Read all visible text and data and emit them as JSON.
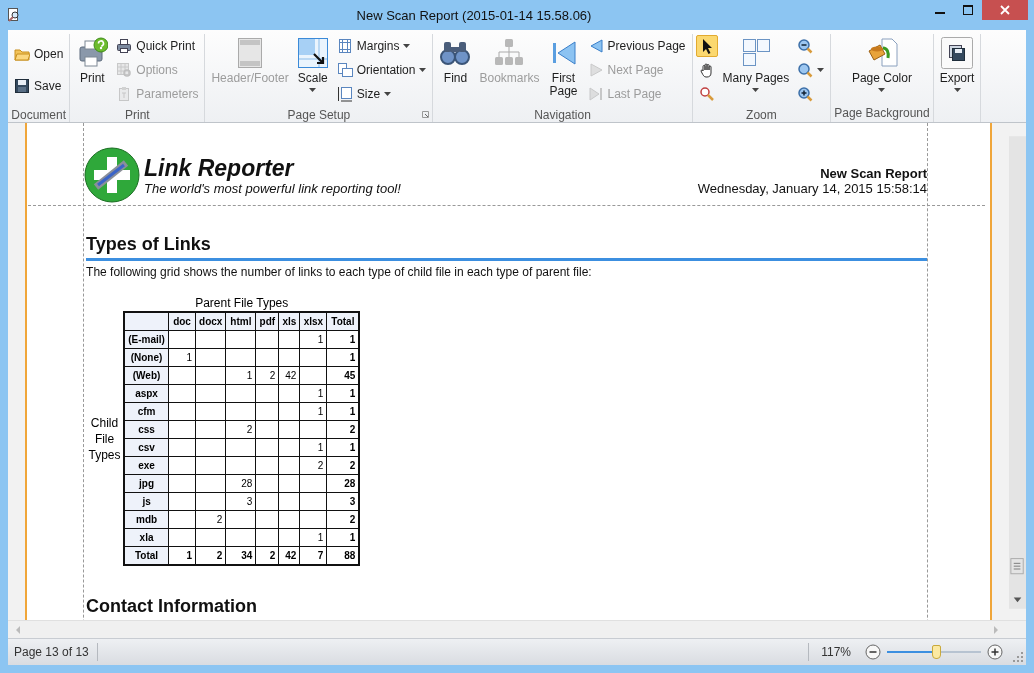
{
  "window": {
    "title": "New Scan Report (2015-01-14 15.58.06)"
  },
  "ribbon": {
    "groups": [
      {
        "label": "Document",
        "items": [
          {
            "label": "Open",
            "kind": "open",
            "disabled": false
          },
          {
            "label": "Save",
            "kind": "save",
            "disabled": false
          }
        ]
      },
      {
        "label": "Print",
        "items": [
          {
            "label": "Print",
            "kind": "print",
            "disabled": false
          },
          {
            "label": "Quick Print",
            "kind": "quickprint",
            "disabled": false
          },
          {
            "label": "Options",
            "kind": "options",
            "disabled": true
          },
          {
            "label": "Parameters",
            "kind": "parameters",
            "disabled": true
          }
        ]
      },
      {
        "label": "Page Setup",
        "launcher": true,
        "items": [
          {
            "label": "Header/Footer",
            "kind": "headerfooter",
            "disabled": true
          },
          {
            "label": "Scale",
            "kind": "scale",
            "disabled": false,
            "dropdown": true
          },
          {
            "label": "Margins",
            "kind": "margins",
            "disabled": false,
            "dropdown": true
          },
          {
            "label": "Orientation",
            "kind": "orientation",
            "disabled": false,
            "dropdown": true
          },
          {
            "label": "Size",
            "kind": "size",
            "disabled": false,
            "dropdown": true
          }
        ]
      },
      {
        "label": "Navigation",
        "items": [
          {
            "label": "Find",
            "kind": "find",
            "disabled": false
          },
          {
            "label": "Bookmarks",
            "kind": "bookmarks",
            "disabled": true
          },
          {
            "label": "First\nPage",
            "kind": "first",
            "disabled": false
          },
          {
            "label": "Previous Page",
            "kind": "previous",
            "disabled": false
          },
          {
            "label": "Next Page",
            "kind": "next",
            "disabled": true
          },
          {
            "label": "Last Page",
            "kind": "last",
            "disabled": true
          }
        ]
      },
      {
        "label": "Zoom",
        "items": [
          {
            "kind": "pointer",
            "disabled": false,
            "selected": true
          },
          {
            "kind": "hand",
            "disabled": false,
            "selected": false
          },
          {
            "kind": "magnifier",
            "disabled": false,
            "selected": false
          },
          {
            "label": "Many Pages",
            "kind": "manypages",
            "disabled": false,
            "dropdown": true
          },
          {
            "kind": "zoomout",
            "disabled": false
          },
          {
            "kind": "zoom",
            "disabled": false,
            "dropdown": true
          },
          {
            "kind": "zoomin",
            "disabled": false
          }
        ]
      },
      {
        "label": "Page Background",
        "items": [
          {
            "label": "Page Color",
            "kind": "pagecolor",
            "disabled": false,
            "dropdown": true
          }
        ]
      },
      {
        "items": [
          {
            "label": "Export",
            "kind": "export",
            "disabled": false,
            "dropdown": true
          }
        ]
      }
    ]
  },
  "report": {
    "brand": "Link Reporter",
    "tagline": "The world's most powerful link reporting tool!",
    "report_title": "New Scan Report",
    "date": "Wednesday, January 14, 2015 15:58:14",
    "section_title": "Types of Links",
    "intro": "The following grid shows the number of links to each type of child file in each type of parent file:",
    "table": {
      "caption": "Parent File Types",
      "row_axis": "Child File Types",
      "columns": [
        "doc",
        "docx",
        "html",
        "pdf",
        "xls",
        "xlsx",
        "Total"
      ],
      "rows": [
        {
          "header": "(E-mail)",
          "cells": [
            null,
            null,
            null,
            null,
            null,
            "1",
            "1"
          ]
        },
        {
          "header": "(None)",
          "cells": [
            "1",
            null,
            null,
            null,
            null,
            null,
            "1"
          ]
        },
        {
          "header": "(Web)",
          "cells": [
            null,
            null,
            "1",
            "2",
            "42",
            null,
            "45"
          ]
        },
        {
          "header": "aspx",
          "cells": [
            null,
            null,
            null,
            null,
            null,
            "1",
            "1"
          ]
        },
        {
          "header": "cfm",
          "cells": [
            null,
            null,
            null,
            null,
            null,
            "1",
            "1"
          ]
        },
        {
          "header": "css",
          "cells": [
            null,
            null,
            "2",
            null,
            null,
            null,
            "2"
          ]
        },
        {
          "header": "csv",
          "cells": [
            null,
            null,
            null,
            null,
            null,
            "1",
            "1"
          ]
        },
        {
          "header": "exe",
          "cells": [
            null,
            null,
            null,
            null,
            null,
            "2",
            "2"
          ]
        },
        {
          "header": "jpg",
          "cells": [
            null,
            null,
            "28",
            null,
            null,
            null,
            "28"
          ]
        },
        {
          "header": "js",
          "cells": [
            null,
            null,
            "3",
            null,
            null,
            null,
            "3"
          ]
        },
        {
          "header": "mdb",
          "cells": [
            null,
            "2",
            null,
            null,
            null,
            null,
            "2"
          ]
        },
        {
          "header": "xla",
          "cells": [
            null,
            null,
            null,
            null,
            null,
            "1",
            "1"
          ]
        },
        {
          "header": "Total",
          "cells": [
            "1",
            "2",
            "34",
            "2",
            "42",
            "7",
            "88"
          ]
        }
      ]
    },
    "next_section_title": "Contact Information"
  },
  "status_bar": {
    "page": "Page 13 of 13",
    "zoom": "117%",
    "zoom_slider": {
      "level": 0.52
    }
  }
}
